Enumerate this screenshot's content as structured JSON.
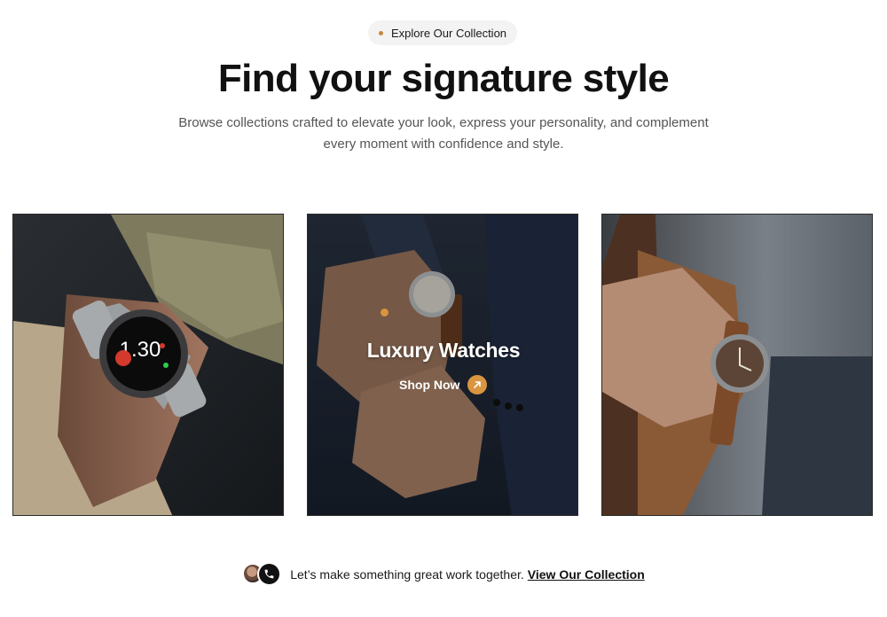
{
  "badge": {
    "label": "Explore Our Collection",
    "dot_color": "#c8883a"
  },
  "header": {
    "title": "Find your signature style",
    "subtitle_line1": "Browse collections crafted to elevate your look, express your personality, and complement",
    "subtitle_line2": "every moment with confidence and style."
  },
  "cards": [
    {
      "image": "smartwatch-on-wrist-photo"
    },
    {
      "image": "luxury-watch-suit-photo",
      "title": "Luxury Watches",
      "cta_label": "Shop Now",
      "accent_color": "#d9953f",
      "cta_icon": "arrow-up-right-icon"
    },
    {
      "image": "leather-strap-watch-photo"
    }
  ],
  "footer": {
    "text": "Let’s make something great work together.",
    "link": "View Our Collection",
    "icons": [
      "avatar",
      "phone-icon"
    ]
  }
}
